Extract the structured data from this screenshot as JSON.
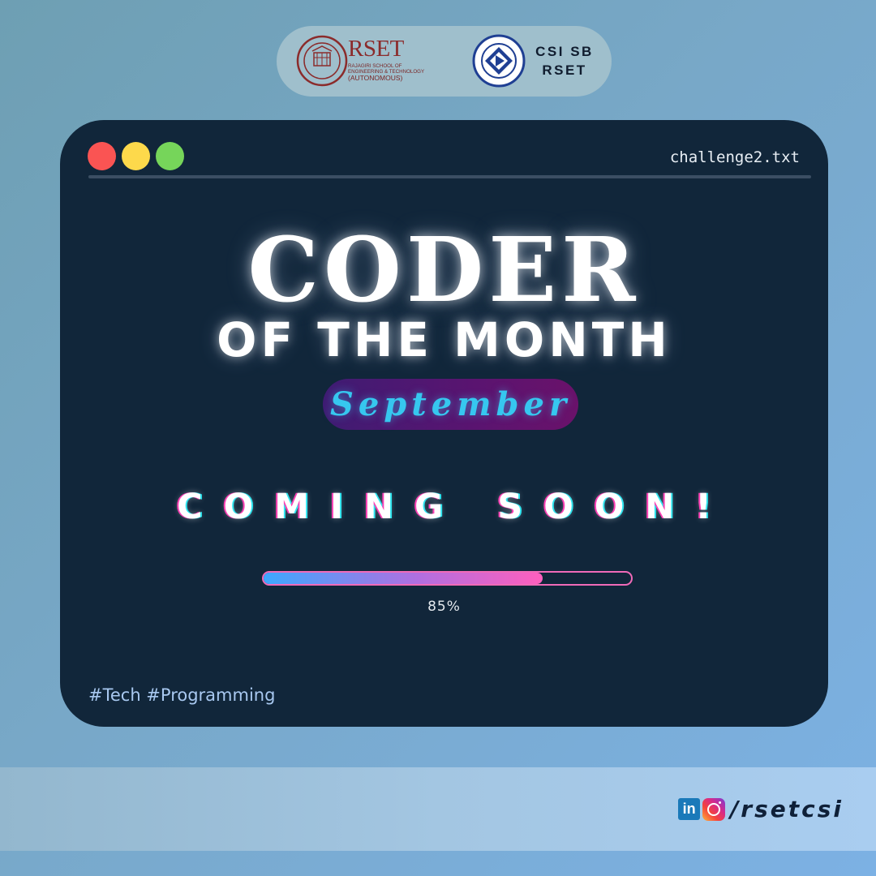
{
  "logos": {
    "rset": {
      "name": "RSET",
      "subtitle": "RAJAGIRI SCHOOL OF ENGINEERING & TECHNOLOGY",
      "autonomous": "(AUTONOMOUS)"
    },
    "csi": {
      "line1": "CSI SB",
      "line2": "RSET"
    }
  },
  "window": {
    "filename": "challenge2.txt",
    "title_line1": "CODER",
    "title_line2": "OF THE MONTH",
    "month": "September",
    "coming_soon": "COMING SOON!",
    "progress": {
      "value": 0.76,
      "label": "85%"
    },
    "hashtags": "#Tech #Programming"
  },
  "footer": {
    "handle": "/rsetcsi",
    "icons": [
      "linkedin-icon",
      "instagram-icon"
    ]
  },
  "colors": {
    "window_bg": "#11263a",
    "dot_red": "#fa5453",
    "dot_yellow": "#fdd94b",
    "dot_green": "#76d55a",
    "month_text": "#36c7ef",
    "progress_border": "#f06ab8"
  }
}
